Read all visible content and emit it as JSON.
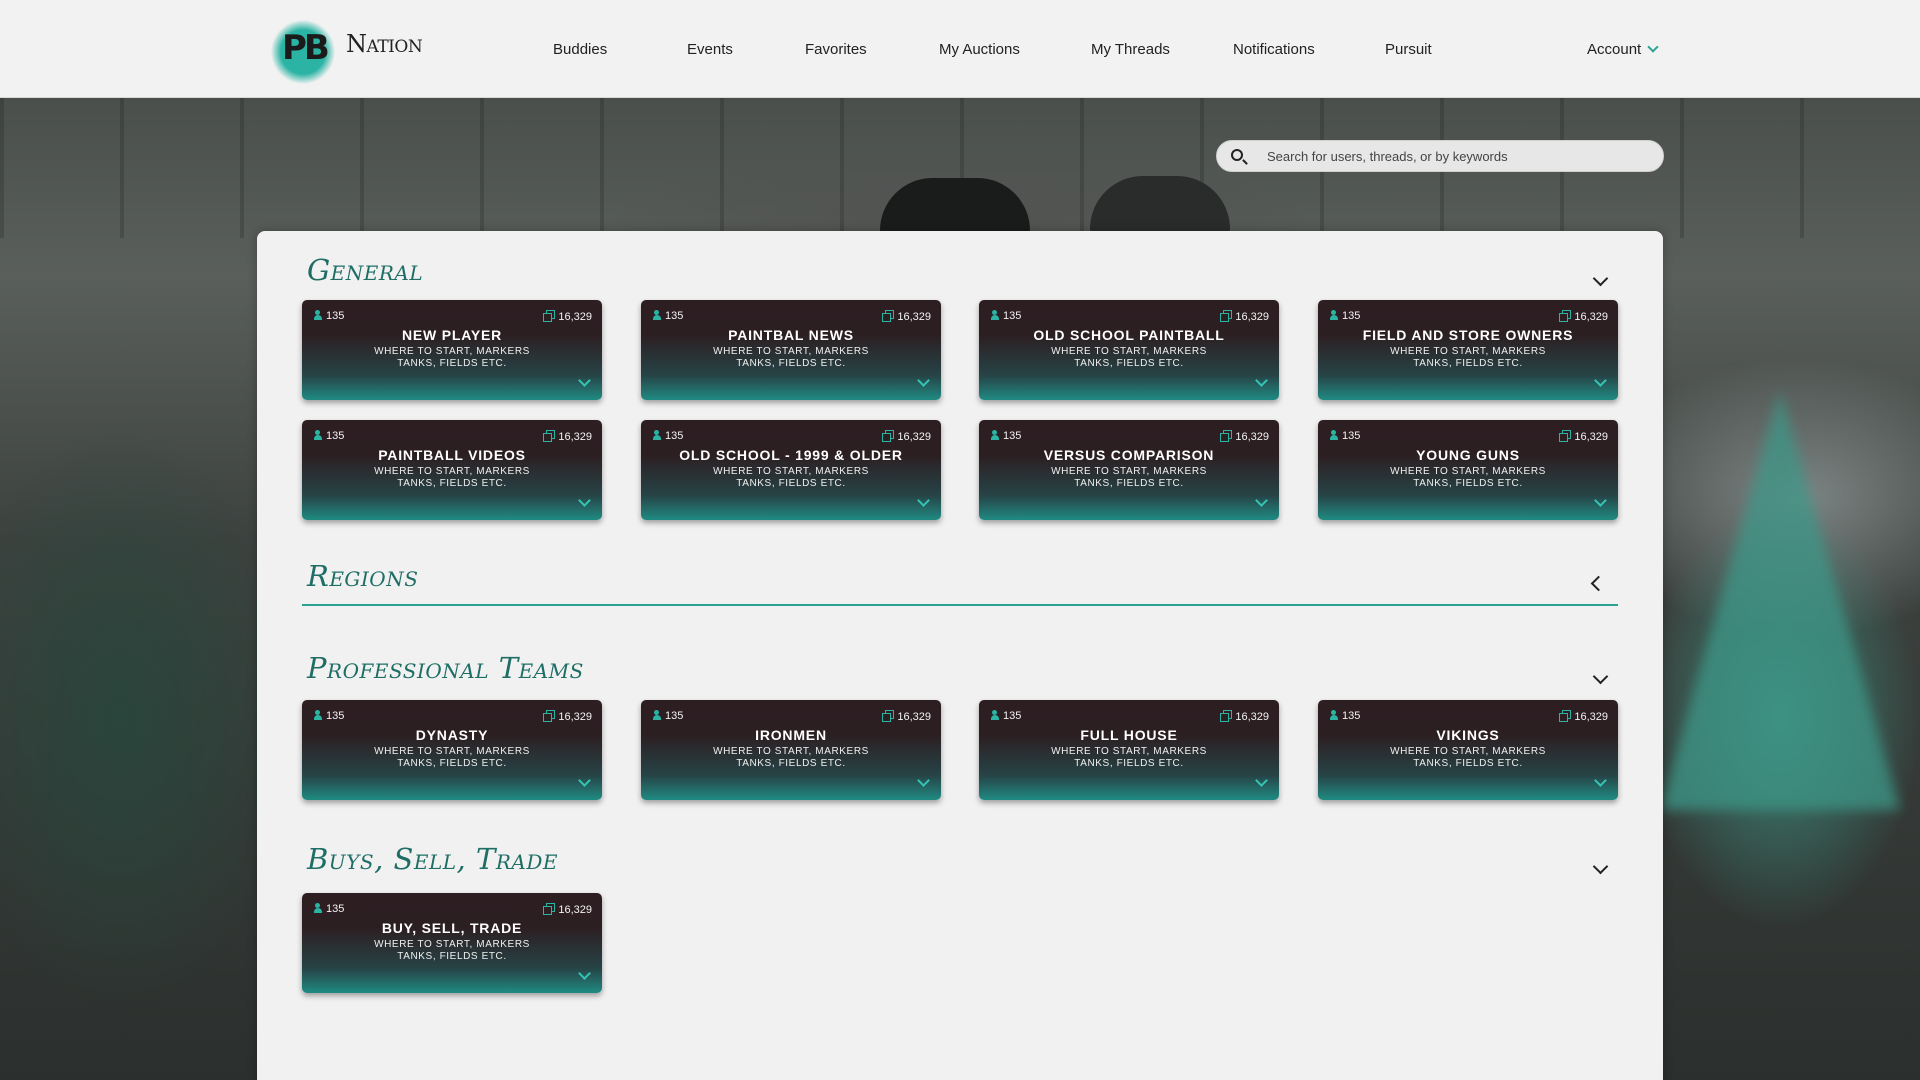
{
  "brand": {
    "logo_pb": "PB",
    "logo_nation": "Nation",
    "accent": "#2aa395"
  },
  "nav": {
    "items": [
      "Buddies",
      "Events",
      "Favorites",
      "My Auctions",
      "My Threads",
      "Notifications",
      "Pursuit"
    ],
    "account_label": "Account"
  },
  "search": {
    "placeholder": "Search for users, threads, or by keywords"
  },
  "sections": {
    "general": {
      "title": "General",
      "cards": [
        {
          "users": "135",
          "posts": "16,329",
          "title": "NEW PLAYER",
          "desc": "WHERE TO START, MARKERS TANKS, FIELDS ETC."
        },
        {
          "users": "135",
          "posts": "16,329",
          "title": "PAINTBAL NEWS",
          "desc": "WHERE TO START, MARKERS TANKS, FIELDS ETC."
        },
        {
          "users": "135",
          "posts": "16,329",
          "title": "OLD SCHOOL PAINTBALL",
          "desc": "WHERE TO START, MARKERS TANKS, FIELDS ETC."
        },
        {
          "users": "135",
          "posts": "16,329",
          "title": "FIELD AND STORE OWNERS",
          "desc": "WHERE TO START, MARKERS TANKS, FIELDS ETC."
        },
        {
          "users": "135",
          "posts": "16,329",
          "title": "PAINTBALL VIDEOS",
          "desc": "WHERE TO START, MARKERS TANKS, FIELDS ETC."
        },
        {
          "users": "135",
          "posts": "16,329",
          "title": "OLD SCHOOL - 1999 & OLDER",
          "desc": "WHERE TO START, MARKERS TANKS, FIELDS ETC."
        },
        {
          "users": "135",
          "posts": "16,329",
          "title": "VERSUS COMPARISON",
          "desc": "WHERE TO START, MARKERS TANKS, FIELDS ETC."
        },
        {
          "users": "135",
          "posts": "16,329",
          "title": "YOUNG GUNS",
          "desc": "WHERE TO START, MARKERS TANKS, FIELDS ETC."
        }
      ]
    },
    "regions": {
      "title": "Regions"
    },
    "professional_teams": {
      "title": "Professional Teams",
      "cards": [
        {
          "users": "135",
          "posts": "16,329",
          "title": "DYNASTY",
          "desc": "WHERE TO START, MARKERS TANKS, FIELDS ETC."
        },
        {
          "users": "135",
          "posts": "16,329",
          "title": "IRONMEN",
          "desc": "WHERE TO START, MARKERS TANKS, FIELDS ETC."
        },
        {
          "users": "135",
          "posts": "16,329",
          "title": "FULL HOUSE",
          "desc": "WHERE TO START, MARKERS TANKS, FIELDS ETC."
        },
        {
          "users": "135",
          "posts": "16,329",
          "title": "VIKINGS",
          "desc": "WHERE TO START, MARKERS TANKS, FIELDS ETC."
        }
      ]
    },
    "buy_sell_trade": {
      "title": "Buys, Sell, Trade",
      "cards": [
        {
          "users": "135",
          "posts": "16,329",
          "title": "BUY, SELL, TRADE",
          "desc": "WHERE TO START, MARKERS TANKS, FIELDS ETC."
        }
      ]
    }
  }
}
